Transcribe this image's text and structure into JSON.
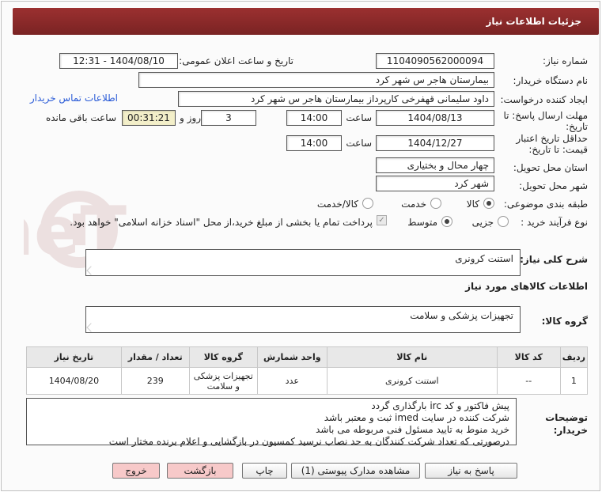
{
  "header": {
    "title": "جزئیات اطلاعات نیاز"
  },
  "form": {
    "need_number_label": "شماره نیاز:",
    "need_number": "1104090562000094",
    "announce_label": "تاریخ و ساعت اعلان عمومی:",
    "announce_value": "1404/08/10 - 12:31",
    "buyer_org_label": "نام دستگاه خریدار:",
    "buyer_org": "بیمارستان هاجر س  شهر کرد",
    "requester_label": "ایجاد کننده درخواست:",
    "requester": "داود سلیمانی قهفرخی کارپرداز بیمارستان هاجر س  شهر کرد",
    "buyer_contact_link": "اطلاعات تماس خریدار",
    "deadline_label_1": "مهلت ارسال پاسخ: تا",
    "deadline_label_2": "تاریخ:",
    "deadline_date": "1404/08/13",
    "time_label": "ساعت",
    "deadline_time": "14:00",
    "days_value": "3",
    "days_label": "روز و",
    "timer": "00:31:21",
    "remaining_label": "ساعت باقی مانده",
    "validity_label_1": "حداقل تاریخ اعتبار",
    "validity_label_2": "قیمت: تا تاریخ:",
    "validity_date": "1404/12/27",
    "validity_time": "14:00",
    "province_label": "استان محل تحویل:",
    "province": "چهار محال و بختیاری",
    "city_label": "شهر محل تحویل:",
    "city": "شهر کرد",
    "category_label": "طبقه بندی موضوعی:",
    "category_options": [
      "کالا",
      "خدمت",
      "کالا/خدمت"
    ],
    "category_selected": "کالا",
    "process_label": "نوع فرآیند خرید :",
    "process_options": [
      "جزیی",
      "متوسط"
    ],
    "process_selected": "متوسط",
    "payment_note": "پرداخت تمام یا بخشی از مبلغ خرید،از محل \"اسناد خزانه اسلامی\" خواهد بود."
  },
  "summary": {
    "label": "شرح کلی نیاز:",
    "value": "استنت کرونری"
  },
  "goods_info_heading": "اطلاعات کالاهای مورد نیاز",
  "goods_group": {
    "label": "گروه کالا:",
    "value": "تجهیزات پزشکی و سلامت"
  },
  "table": {
    "headers": [
      "ردیف",
      "کد کالا",
      "نام کالا",
      "واحد شمارش",
      "گروه کالا",
      "تعداد / مقدار",
      "تاریخ نیاز"
    ],
    "rows": [
      [
        "1",
        "--",
        "استنت کرونری",
        "عدد",
        "تجهیزات پزشکی و سلامت",
        "239",
        "1404/08/20"
      ]
    ]
  },
  "buyer_notes": {
    "label_1": "توضیحات",
    "label_2": "خریدار:",
    "lines": [
      "پیش فاکتور و کد irc بارگذاری گردد",
      "شرکت کننده در سایت imed ثبت و معتبر باشد",
      "خرید منوط به تایید مسئول فنی مربوطه می باشد",
      "درصورتی که تعداد شرکت کنندگان به حد نصاب نرسید کمسیون در بازگشایی و اعلام برنده مختار است"
    ]
  },
  "buttons": {
    "reply": "پاسخ به نیاز",
    "view_docs": "مشاهده مدارک پیوستی (1)",
    "print": "چاپ",
    "back": "بازگشت",
    "exit": "خروج"
  },
  "watermark": "AriaTender.neT",
  "colors": {
    "title_bg": "#8a2a2a",
    "link": "#2a5bd7",
    "timer_bg": "#f3efc9"
  }
}
